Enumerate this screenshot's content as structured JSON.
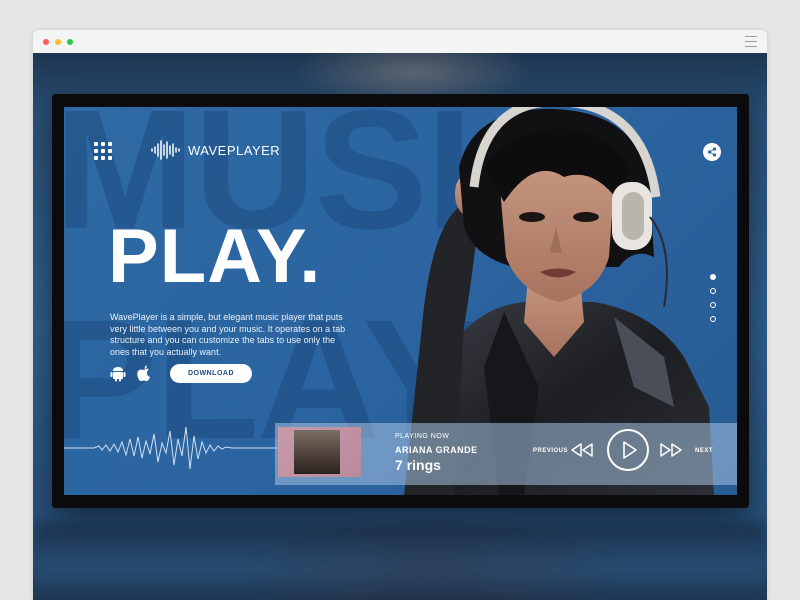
{
  "browser": {
    "menu_icon": "hamburger-icon"
  },
  "hero": {
    "bg_word_top": "MUSIC",
    "bg_word_bottom": "PLAY",
    "headline": "PLAY.",
    "description": "WavePlayer is a simple, but elegant music player that puts very little between you and your music. It operates on a tab structure and you can customize the tabs to use only the ones that you actually want.",
    "download_label": "DOWNLOAD"
  },
  "header": {
    "logo_text": "WAVEPLAYER",
    "menu_icon": "grid-icon",
    "share_icon": "share-icon"
  },
  "pagination": {
    "total": 4,
    "active_index": 0
  },
  "player": {
    "now_playing_label": "PLAYING NOW",
    "artist": "ARIANA GRANDE",
    "track": "7 rings",
    "previous_label": "PREVIOUS",
    "next_label": "NEXT"
  },
  "colors": {
    "accent_blue": "#2e6aa4",
    "button_text": "#1e4e82",
    "player_bar": "#a8c3e1"
  }
}
